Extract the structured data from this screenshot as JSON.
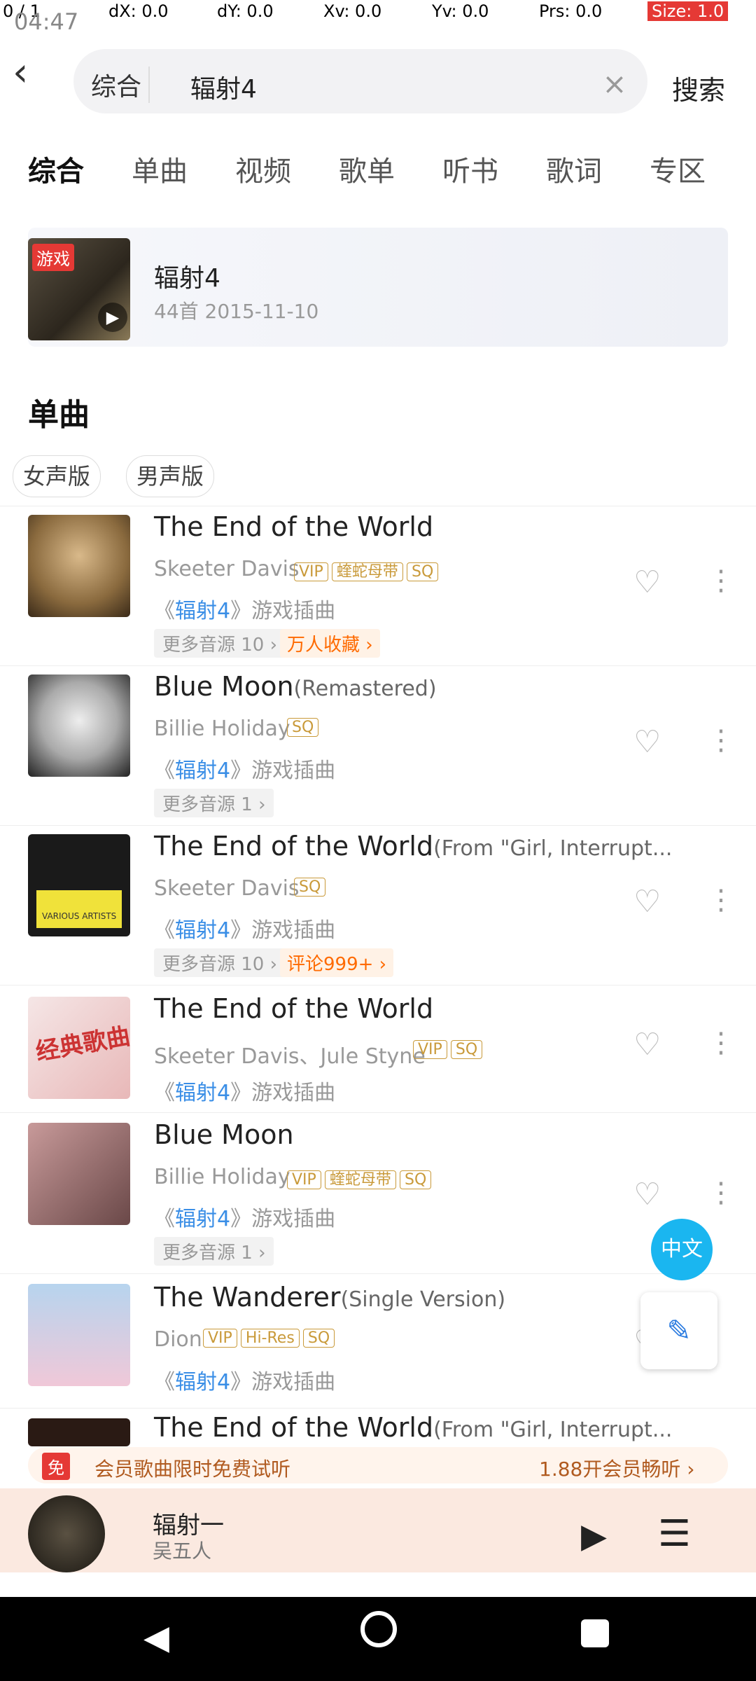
{
  "devbar": {
    "pointer": "0 / 1",
    "dx": "dX: 0.0",
    "dy": "dY: 0.0",
    "xv": "Xv: 0.0",
    "yv": "Yv: 0.0",
    "prs": "Prs: 0.0",
    "size": "Size: 1.0"
  },
  "statusbar": {
    "time": "04:47"
  },
  "search": {
    "chip": "综合",
    "query": "辐射4",
    "clear": "×",
    "button": "搜索"
  },
  "tabs": [
    "综合",
    "单曲",
    "视频",
    "歌单",
    "听书",
    "歌词",
    "专区"
  ],
  "top_result": {
    "badge": "游戏",
    "title": "辐射4",
    "subtitle": "44首 2015-11-10"
  },
  "section": {
    "title": "单曲"
  },
  "subtabs": [
    "女声版",
    "男声版"
  ],
  "songs": [
    {
      "title": "The End of the World",
      "ext": "",
      "artist": "Skeeter Davis",
      "tag1": "VIP",
      "tag2": "蝰蛇母带",
      "tag3": "SQ",
      "album_prefix": "《",
      "album": "辐射4",
      "album_suffix": "》游戏插曲",
      "more": "更多音源 10 ›",
      "extra": "万人收藏 ›"
    },
    {
      "title": "Blue Moon",
      "ext": "(Remastered)",
      "artist": "Billie Holiday",
      "tag1": "SQ",
      "album_prefix": "《",
      "album": "辐射4",
      "album_suffix": "》游戏插曲",
      "more": "更多音源 1 ›"
    },
    {
      "title": "The End of the World",
      "ext": "(From \"Girl, Interrupt...",
      "artist": "Skeeter Davis",
      "tag1": "SQ",
      "album_prefix": "《",
      "album": "辐射4",
      "album_suffix": "》游戏插曲",
      "more": "更多音源 10 ›",
      "extra": "评论999+ ›"
    },
    {
      "title": "The End of the World",
      "ext": "",
      "artist": "Skeeter Davis、Jule Styne",
      "tag1": "VIP",
      "tag2": "SQ",
      "album_prefix": "《",
      "album": "辐射4",
      "album_suffix": "》游戏插曲"
    },
    {
      "title": "Blue Moon",
      "ext": "",
      "artist": "Billie Holiday",
      "tag1": "VIP",
      "tag2": "蝰蛇母带",
      "tag3": "SQ",
      "album_prefix": "《",
      "album": "辐射4",
      "album_suffix": "》游戏插曲",
      "more": "更多音源 1 ›"
    },
    {
      "title": "The Wanderer",
      "ext": "(Single Version)",
      "artist": "Dion",
      "tag1": "VIP",
      "tag2": "Hi-Res",
      "tag3": "SQ",
      "album_prefix": "《",
      "album": "辐射4",
      "album_suffix": "》游戏插曲"
    },
    {
      "title": "The End of the World",
      "ext": "(From \"Girl, Interrupt..."
    }
  ],
  "cover_labels": {
    "s2": "VARIOUS ARTISTS",
    "s3": "经典歌曲"
  },
  "vip_banner": {
    "free": "免",
    "text": "会员歌曲限时免费试听",
    "cta": "1.88开会员畅听 ›"
  },
  "player": {
    "title": "辐射一",
    "sub": "吴五人"
  },
  "fab": {
    "label": "中文"
  },
  "colors": {
    "accent": "#3a8ee6",
    "badge": "#e53935",
    "vip": "#c99a3a"
  }
}
